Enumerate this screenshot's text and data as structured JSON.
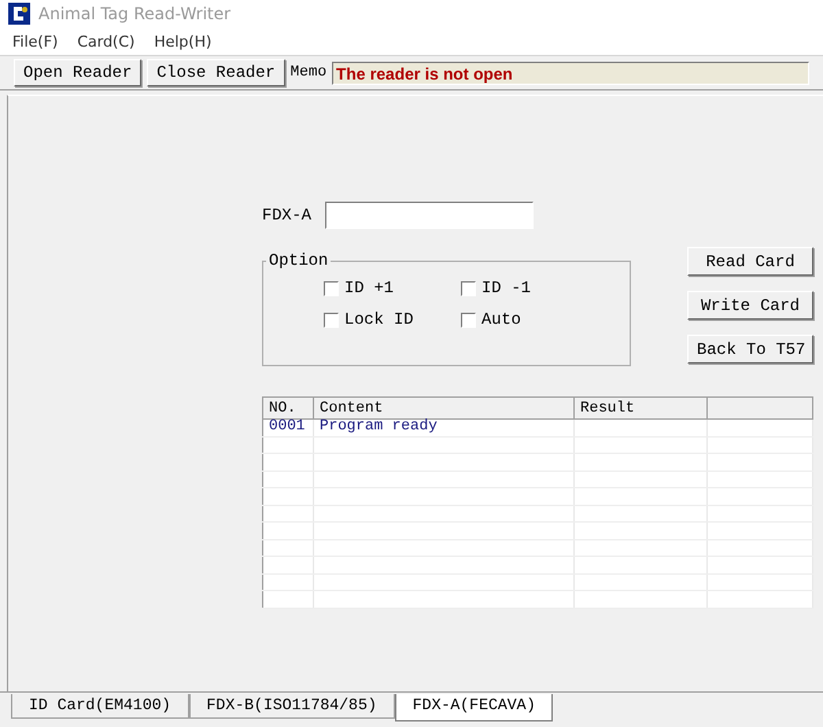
{
  "window": {
    "title": "Animal Tag Read-Writer"
  },
  "menu": [
    "File(F)",
    "Card(C)",
    "Help(H)"
  ],
  "toolbar": {
    "buttons": [
      "Open Reader",
      "Close Reader"
    ],
    "memo_label": "Memo",
    "memo_value": "The reader is not open"
  },
  "form": {
    "field_label": "FDX-A"
  },
  "options": {
    "title": "Option",
    "checkboxes": [
      {
        "label": "ID +1",
        "checked": false
      },
      {
        "label": "ID -1",
        "checked": false
      },
      {
        "label": "Lock ID",
        "checked": false
      },
      {
        "label": "Auto",
        "checked": false
      }
    ]
  },
  "actions": [
    "Read Card",
    "Write Card",
    "Back To T57"
  ],
  "table": {
    "columns": [
      "NO.",
      "Content",
      "Result"
    ],
    "rows": [
      {
        "no": "0001",
        "content": "Program ready"
      }
    ]
  },
  "tabs": [
    {
      "label": "ID Card(EM4100)",
      "selected": false
    },
    {
      "label": "FDX-B(ISO11784/85)",
      "selected": false
    },
    {
      "label": "FDX-A(FECAVA)",
      "selected": true
    }
  ]
}
